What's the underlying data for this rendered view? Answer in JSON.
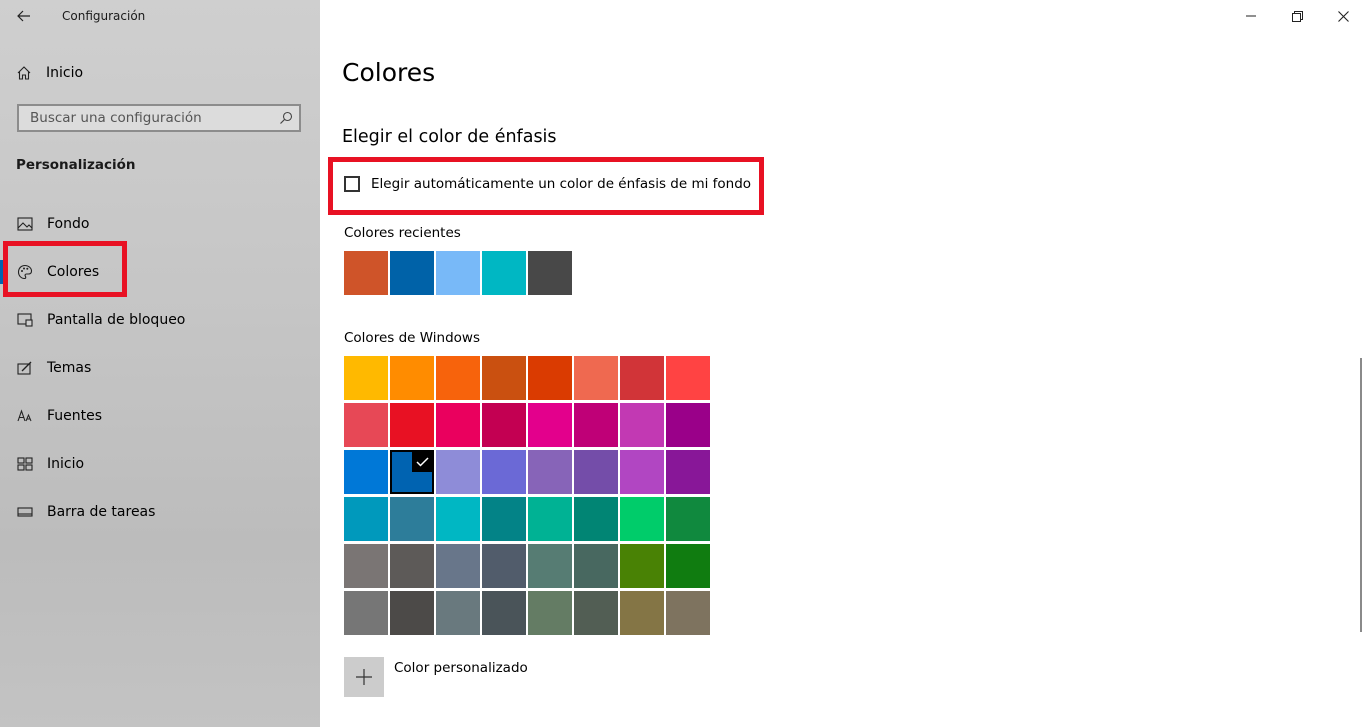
{
  "window": {
    "title": "Configuración",
    "controls": [
      "minimize-icon",
      "restore-icon",
      "close-icon"
    ]
  },
  "sidebar": {
    "home_label": "Inicio",
    "search_placeholder": "Buscar una configuración",
    "section": "Personalización",
    "items": [
      {
        "label": "Fondo",
        "icon": "picture-icon"
      },
      {
        "label": "Colores",
        "icon": "palette-icon",
        "active": true
      },
      {
        "label": "Pantalla de bloqueo",
        "icon": "lock-screen-icon"
      },
      {
        "label": "Temas",
        "icon": "themes-icon"
      },
      {
        "label": "Fuentes",
        "icon": "fonts-icon"
      },
      {
        "label": "Inicio",
        "icon": "start-icon"
      },
      {
        "label": "Barra de tareas",
        "icon": "taskbar-icon"
      }
    ]
  },
  "main": {
    "title": "Colores",
    "accent_heading": "Elegir el color de énfasis",
    "auto_accent_label": "Elegir automáticamente un color de énfasis de mi fondo",
    "auto_accent_checked": false,
    "recent_heading": "Colores recientes",
    "recent_colors": [
      "#cf5429",
      "#0062a8",
      "#78b9f8",
      "#00b7c3",
      "#484848"
    ],
    "windows_heading": "Colores de Windows",
    "windows_colors": [
      "#ffb900",
      "#ff8c00",
      "#f7630c",
      "#ca5010",
      "#da3b01",
      "#ef6950",
      "#d13438",
      "#ff4343",
      "#e74856",
      "#e81123",
      "#ea005e",
      "#c30052",
      "#e3008c",
      "#bf0077",
      "#c239b3",
      "#9a0089",
      "#0078d7",
      "#0063b1",
      "#8e8cd8",
      "#6b69d6",
      "#8764b8",
      "#744da9",
      "#b146c2",
      "#881798",
      "#0099bc",
      "#2d7d9a",
      "#00b7c3",
      "#038387",
      "#00b294",
      "#018574",
      "#00cc6a",
      "#10893e",
      "#7a7574",
      "#5d5a58",
      "#68768a",
      "#515c6b",
      "#567c73",
      "#486860",
      "#498205",
      "#107c10",
      "#767676",
      "#4c4a48",
      "#69797e",
      "#4a5459",
      "#647c64",
      "#525e54",
      "#847545",
      "#7e735f"
    ],
    "selected_color_index": 17,
    "custom_color_label": "Color personalizado"
  },
  "annotation_color": "#e81123"
}
